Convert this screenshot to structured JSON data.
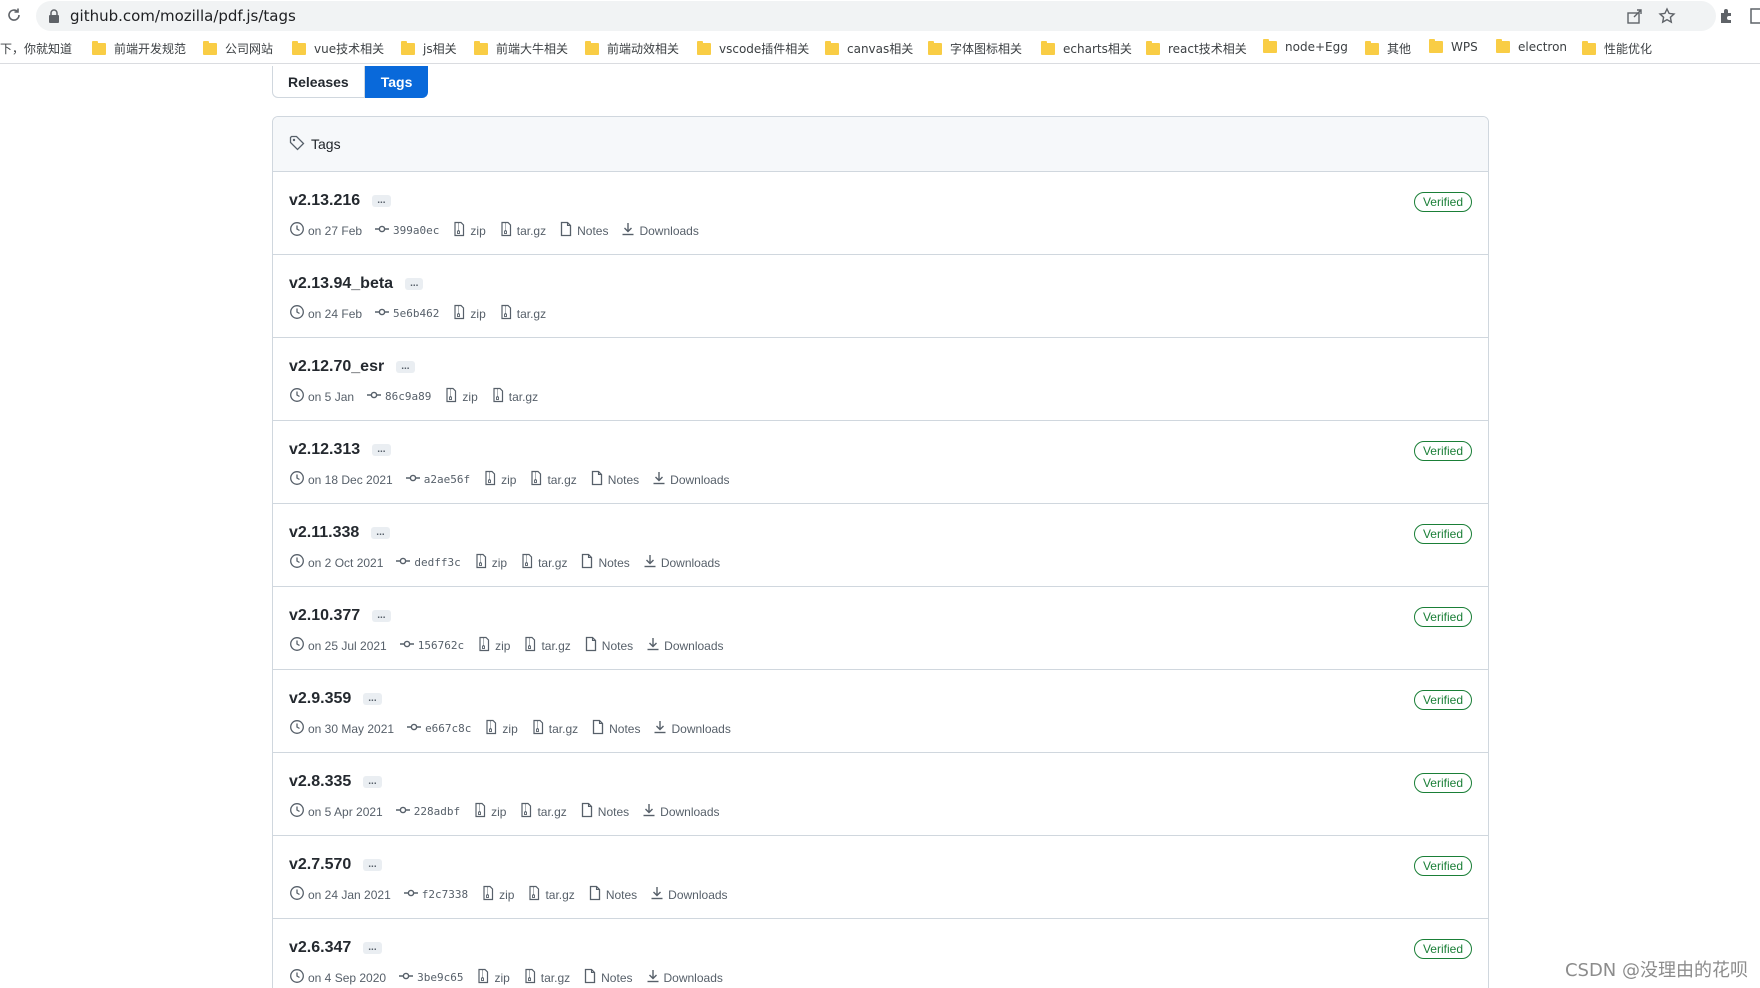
{
  "browser": {
    "url": "github.com/mozilla/pdf.js/tags",
    "bookmarks": [
      "下，你就知道",
      "前端开发规范",
      "公司网站",
      "vue技术相关",
      "js相关",
      "前端大牛相关",
      "前端动效相关",
      "vscode插件相关",
      "canvas相关",
      "字体图标相关",
      "echarts相关",
      "react技术相关",
      "node+Egg",
      "其他",
      "WPS",
      "electron",
      "性能优化"
    ]
  },
  "tabs": {
    "releases": "Releases",
    "tags": "Tags"
  },
  "panel": {
    "title": "Tags"
  },
  "labels": {
    "zip": "zip",
    "targz": "tar.gz",
    "notes": "Notes",
    "downloads": "Downloads",
    "verified": "Verified",
    "ellipsis": "..."
  },
  "tags": [
    {
      "name": "v2.13.216",
      "date": "on 27 Feb",
      "sha": "399a0ec",
      "verified": true,
      "notes": true
    },
    {
      "name": "v2.13.94_beta",
      "date": "on 24 Feb",
      "sha": "5e6b462",
      "verified": false,
      "notes": false
    },
    {
      "name": "v2.12.70_esr",
      "date": "on 5 Jan",
      "sha": "86c9a89",
      "verified": false,
      "notes": false
    },
    {
      "name": "v2.12.313",
      "date": "on 18 Dec 2021",
      "sha": "a2ae56f",
      "verified": true,
      "notes": true
    },
    {
      "name": "v2.11.338",
      "date": "on 2 Oct 2021",
      "sha": "dedff3c",
      "verified": true,
      "notes": true
    },
    {
      "name": "v2.10.377",
      "date": "on 25 Jul 2021",
      "sha": "156762c",
      "verified": true,
      "notes": true
    },
    {
      "name": "v2.9.359",
      "date": "on 30 May 2021",
      "sha": "e667c8c",
      "verified": true,
      "notes": true
    },
    {
      "name": "v2.8.335",
      "date": "on 5 Apr 2021",
      "sha": "228adbf",
      "verified": true,
      "notes": true
    },
    {
      "name": "v2.7.570",
      "date": "on 24 Jan 2021",
      "sha": "f2c7338",
      "verified": true,
      "notes": true
    },
    {
      "name": "v2.6.347",
      "date": "on 4 Sep 2020",
      "sha": "3be9c65",
      "verified": true,
      "notes": true
    }
  ],
  "watermark": "CSDN @没理由的花呗"
}
